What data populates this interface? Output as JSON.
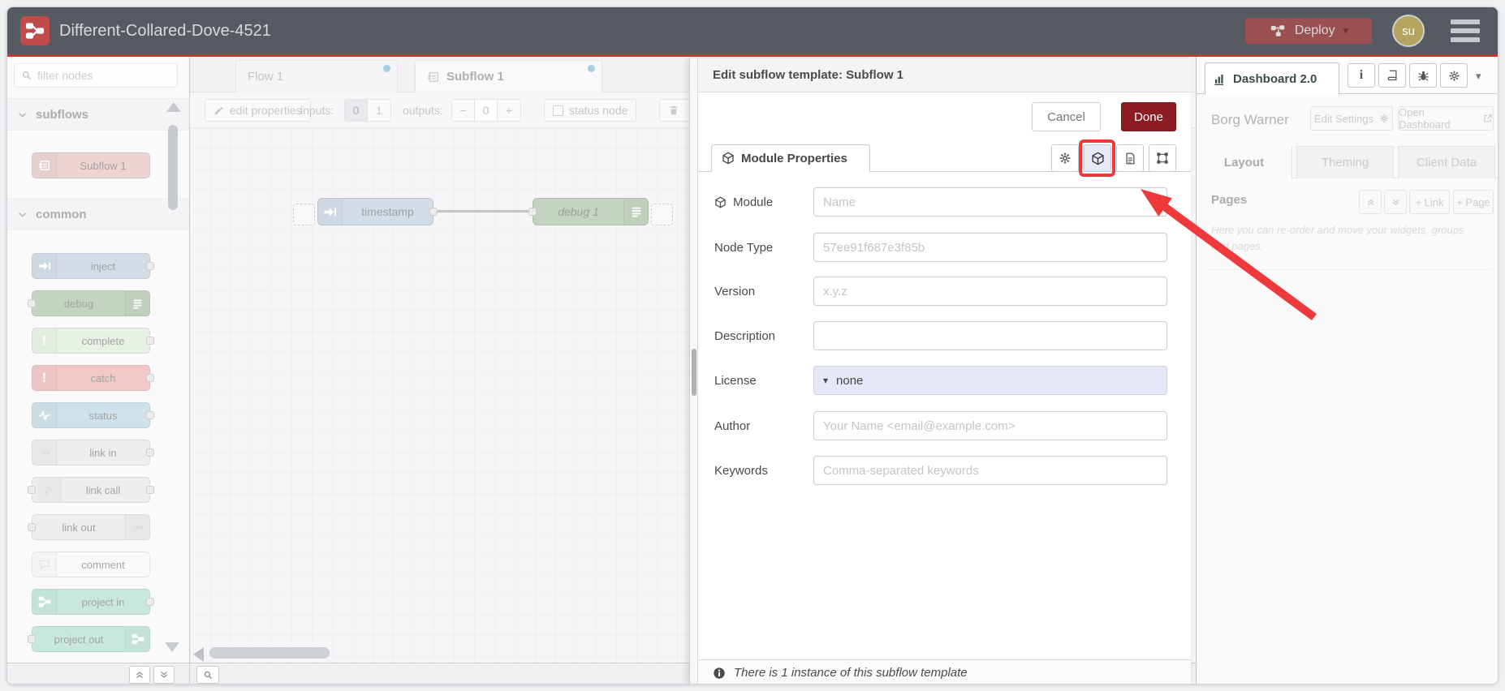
{
  "header": {
    "title": "Different-Collared-Dove-4521",
    "deploy_label": "Deploy",
    "avatar_initials": "su"
  },
  "palette": {
    "filter_placeholder": "filter nodes",
    "sections": [
      {
        "label": "subflows",
        "items": [
          {
            "label": "Subflow 1"
          }
        ]
      },
      {
        "label": "common",
        "items": [
          {
            "label": "inject"
          },
          {
            "label": "debug"
          },
          {
            "label": "complete"
          },
          {
            "label": "catch"
          },
          {
            "label": "status"
          },
          {
            "label": "link in"
          },
          {
            "label": "link call"
          },
          {
            "label": "link out"
          },
          {
            "label": "comment"
          },
          {
            "label": "project in"
          },
          {
            "label": "project out"
          }
        ]
      }
    ]
  },
  "tabs": {
    "flow": "Flow 1",
    "subflow": "Subflow 1"
  },
  "toolbar": {
    "edit_properties": "edit properties",
    "inputs_label": "inputs:",
    "inputs_options": [
      "0",
      "1"
    ],
    "outputs_label": "outputs:",
    "outputs_minus": "−",
    "outputs_value": "0",
    "outputs_plus": "+",
    "status_node": "status node"
  },
  "canvas": {
    "nodes": [
      {
        "label": "timestamp"
      },
      {
        "label": "debug 1"
      }
    ]
  },
  "dialog": {
    "title": "Edit subflow template: Subflow 1",
    "cancel": "Cancel",
    "done": "Done",
    "tab": "Module Properties",
    "fields": {
      "module": {
        "label": "Module",
        "placeholder": "Name"
      },
      "node_type": {
        "label": "Node Type",
        "placeholder": "57ee91f687e3f85b"
      },
      "version": {
        "label": "Version",
        "placeholder": "x.y.z"
      },
      "description": {
        "label": "Description",
        "placeholder": ""
      },
      "license": {
        "label": "License",
        "value": "none"
      },
      "author": {
        "label": "Author",
        "placeholder": "Your Name <email@example.com>"
      },
      "keywords": {
        "label": "Keywords",
        "placeholder": "Comma-separated keywords"
      }
    },
    "footer_note": "There is 1 instance of this subflow template"
  },
  "sidebar": {
    "tab": "Dashboard 2.0",
    "project": "Borg Warner",
    "edit_settings": "Edit Settings",
    "open_dashboard": "Open Dashboard",
    "tabs": [
      "Layout",
      "Theming",
      "Client Data"
    ],
    "pages_title": "Pages",
    "link_button": "+ Link",
    "page_button": "+ Page",
    "help_text": "Here you can re-order and move your widgets, groups and pages."
  },
  "colors": {
    "annotation_red": "#ee3a3a",
    "header_bg": "#565b62",
    "deploy_bg": "#9a5050",
    "done_bg": "#8c1c23",
    "tab_dot": "#4da1c0",
    "node_subflow": "#d7a9a2",
    "node_inject": "#a6bbcf",
    "node_debug": "#87a980",
    "node_complete": "#cfe5ca",
    "node_catch": "#e49191",
    "node_status": "#9fc2d4",
    "node_link": "#dddddd",
    "node_comment": "#f5f5f5",
    "node_project": "#8fcfbf"
  }
}
